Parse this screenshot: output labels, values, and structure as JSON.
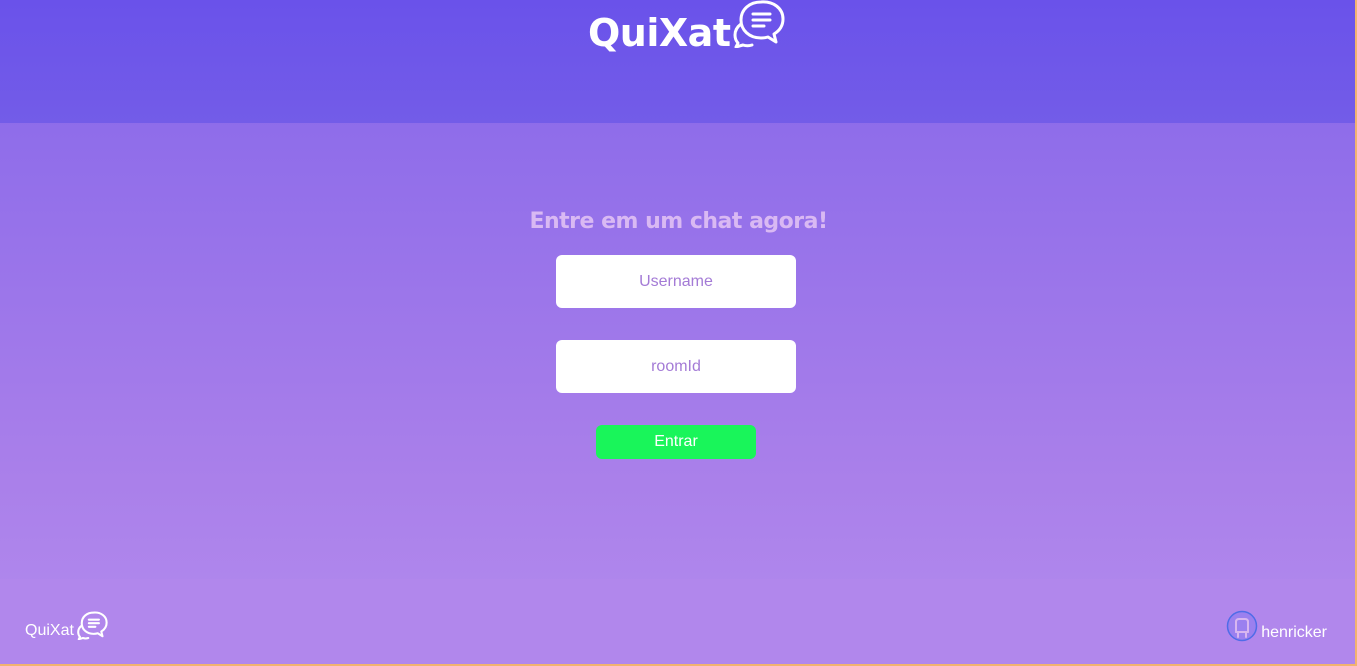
{
  "header": {
    "brand": "QuiXat",
    "brand_icon": "chat-bubbles-icon"
  },
  "main": {
    "title": "Entre em um chat agora!",
    "username_placeholder": "Username",
    "room_placeholder": "roomId",
    "submit_label": "Entrar"
  },
  "footer": {
    "brand": "QuiXat",
    "brand_icon": "chat-bubbles-icon",
    "user": "henricker",
    "user_icon": "github-icon"
  },
  "colors": {
    "header_bg": "#6a52ea",
    "accent_green": "#19f55a",
    "title_color": "#d9b9f3",
    "footer_bg": "#b187ec"
  }
}
